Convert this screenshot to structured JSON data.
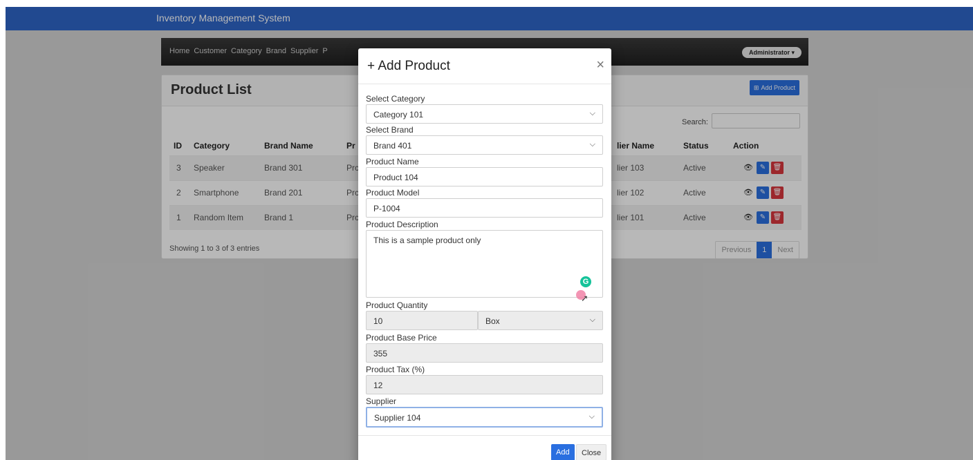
{
  "app": {
    "title": "Inventory Management System"
  },
  "nav": {
    "links": [
      "Home",
      "Customer",
      "Category",
      "Brand",
      "Supplier",
      "P"
    ],
    "user": "Administrator ▾"
  },
  "product_list": {
    "title": "Product List",
    "add_button": "Add Product",
    "search_label": "Search:",
    "columns": [
      "ID",
      "Category",
      "Brand Name",
      "Pr",
      "lier Name",
      "Status",
      "Action"
    ],
    "rows": [
      {
        "id": "3",
        "category": "Speaker",
        "brand": "Brand 301",
        "product": "Prc",
        "supplier": "lier 103",
        "status": "Active"
      },
      {
        "id": "2",
        "category": "Smartphone",
        "brand": "Brand 201",
        "product": "Prc",
        "supplier": "lier 102",
        "status": "Active"
      },
      {
        "id": "1",
        "category": "Random Item",
        "brand": "Brand 1",
        "product": "Prc",
        "supplier": "lier 101",
        "status": "Active"
      }
    ],
    "showing": "Showing 1 to 3 of 3 entries",
    "pager": {
      "previous": "Previous",
      "current": "1",
      "next": "Next"
    }
  },
  "modal": {
    "title": "+ Add Product",
    "close_glyph": "×",
    "fields": {
      "category_label": "Select Category",
      "category_value": "Category 101",
      "brand_label": "Select Brand",
      "brand_value": "Brand 401",
      "name_label": "Product Name",
      "name_value": "Product 104",
      "model_label": "Product Model",
      "model_value": "P-1004",
      "description_label": "Product Description",
      "description_value": "This is a sample product only",
      "quantity_label": "Product Quantity",
      "quantity_value": "10",
      "unit_value": "Box",
      "base_price_label": "Product Base Price",
      "base_price_value": "355",
      "tax_label": "Product Tax (%)",
      "tax_value": "12",
      "supplier_label": "Supplier",
      "supplier_value": "Supplier 104"
    },
    "grammarly_glyph": "G",
    "footer": {
      "add": "Add",
      "close": "Close"
    }
  },
  "colors": {
    "appbar": "#2f66c8",
    "primary": "#2a6fe0",
    "danger": "#d9363e"
  }
}
